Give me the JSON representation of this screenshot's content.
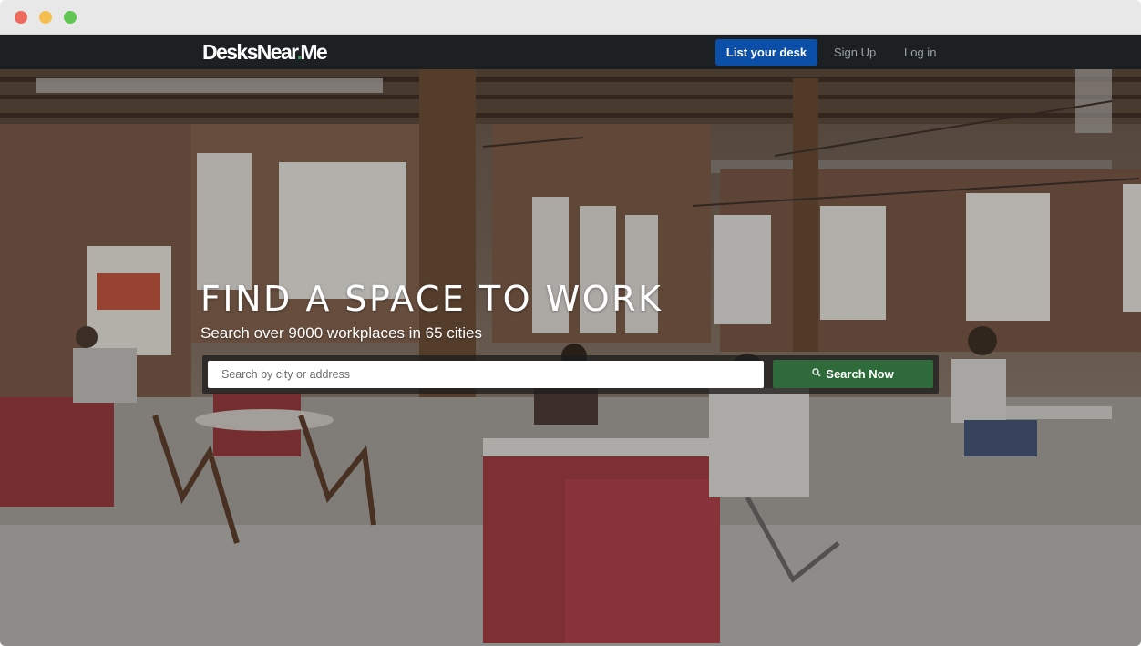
{
  "navbar": {
    "logo_part1": "Desks",
    "logo_part2": "Near",
    "logo_dot": ".",
    "logo_part3": "Me",
    "list_desk_label": "List your desk",
    "signup_label": "Sign Up",
    "login_label": "Log in"
  },
  "hero": {
    "headline": "FIND A SPACE TO WORK",
    "subheadline": "Search over 9000 workplaces in 65 cities",
    "search_placeholder": "Search by city or address",
    "search_button_label": "Search Now",
    "search_icon": "search-icon"
  },
  "colors": {
    "navbar_bg": "#1d2022",
    "primary_button": "#0b4fa8",
    "search_button": "#2f6b3a",
    "logo_dot": "#3b8d4f"
  }
}
